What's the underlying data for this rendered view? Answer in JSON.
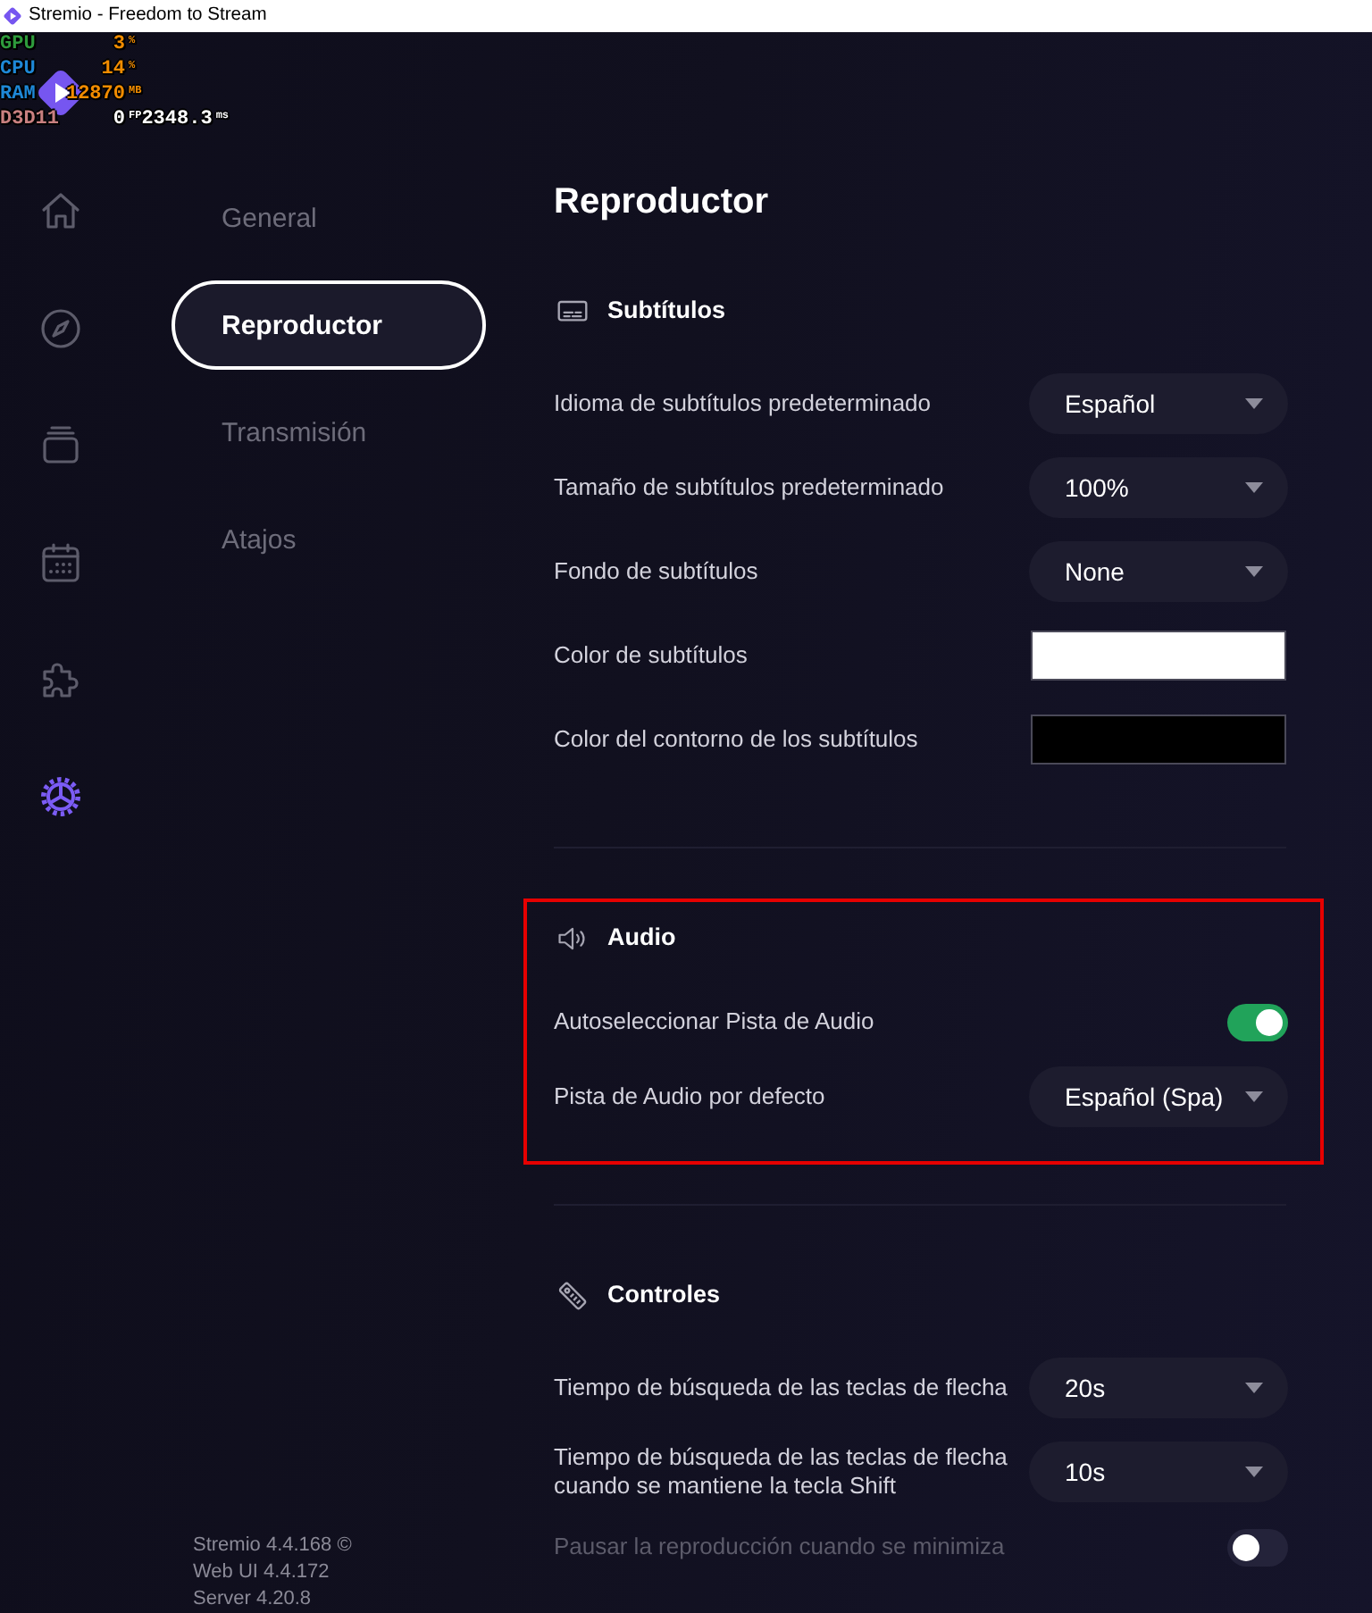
{
  "window": {
    "title": "Stremio - Freedom to Stream"
  },
  "overlay": {
    "rows": [
      {
        "label": "GPU",
        "color": "#2e9b3c",
        "readings": [
          {
            "value": "3",
            "unit": "%",
            "color": "#f28c00"
          }
        ]
      },
      {
        "label": "CPU",
        "color": "#1e88d6",
        "readings": [
          {
            "value": "14",
            "unit": "%",
            "color": "#f28c00"
          }
        ]
      },
      {
        "label": "RAM",
        "color": "#1e88d6",
        "readings": [
          {
            "value": "12870",
            "unit": "MB",
            "color": "#f28c00"
          }
        ]
      },
      {
        "label": "D3D11",
        "color": "#c98080",
        "readings": [
          {
            "value": "0",
            "unit": "FP",
            "color": "#ffffff"
          },
          {
            "value": "2348.3",
            "unit": "ms",
            "color": "#ffffff"
          }
        ]
      }
    ]
  },
  "nav_rail": {
    "items": [
      {
        "kind": "home",
        "selected": false
      },
      {
        "kind": "discover",
        "selected": false
      },
      {
        "kind": "library",
        "selected": false
      },
      {
        "kind": "calendar",
        "selected": false
      },
      {
        "kind": "addons",
        "selected": false
      },
      {
        "kind": "settings",
        "selected": true
      }
    ]
  },
  "settings_menu": {
    "items": [
      {
        "label": "General",
        "selected": false
      },
      {
        "label": "Reproductor",
        "selected": true
      },
      {
        "label": "Transmisión",
        "selected": false
      },
      {
        "label": "Atajos",
        "selected": false
      }
    ],
    "version_lines": [
      "Stremio 4.4.168 ©",
      "Web UI 4.4.172",
      "Server 4.20.8"
    ]
  },
  "content": {
    "title": "Reproductor",
    "sections": [
      {
        "kind": "subtitles",
        "title": "Subtítulos",
        "highlighted": false,
        "settings": [
          {
            "kind": "dropdown",
            "label": "Idioma de subtítulos predeterminado",
            "value": "Español",
            "disabled": false
          },
          {
            "kind": "dropdown",
            "label": "Tamaño de subtítulos predeterminado",
            "value": "100%",
            "disabled": false
          },
          {
            "kind": "dropdown",
            "label": "Fondo de subtítulos",
            "value": "None",
            "disabled": false
          },
          {
            "kind": "color",
            "label": "Color de subtítulos",
            "color": "#ffffff",
            "disabled": false
          },
          {
            "kind": "color",
            "label": "Color del contorno de los subtítulos",
            "color": "#000000",
            "disabled": false
          }
        ]
      },
      {
        "kind": "audio",
        "title": "Audio",
        "highlighted": true,
        "settings": [
          {
            "kind": "toggle",
            "label": "Autoseleccionar Pista de Audio",
            "on": true,
            "disabled": false
          },
          {
            "kind": "dropdown",
            "label": "Pista de Audio por defecto",
            "value": "Español (Spa)",
            "disabled": false
          }
        ]
      },
      {
        "kind": "controls",
        "title": "Controles",
        "highlighted": false,
        "settings": [
          {
            "kind": "dropdown",
            "label": "Tiempo de búsqueda de las teclas de flecha",
            "value": "20s",
            "disabled": false
          },
          {
            "kind": "dropdown",
            "label": "Tiempo de búsqueda de las teclas de flecha cuando se mantiene la tecla Shift",
            "value": "10s",
            "disabled": false
          },
          {
            "kind": "toggle",
            "label": "Pausar la reproducción cuando se minimiza",
            "on": false,
            "disabled": true
          }
        ]
      }
    ]
  }
}
